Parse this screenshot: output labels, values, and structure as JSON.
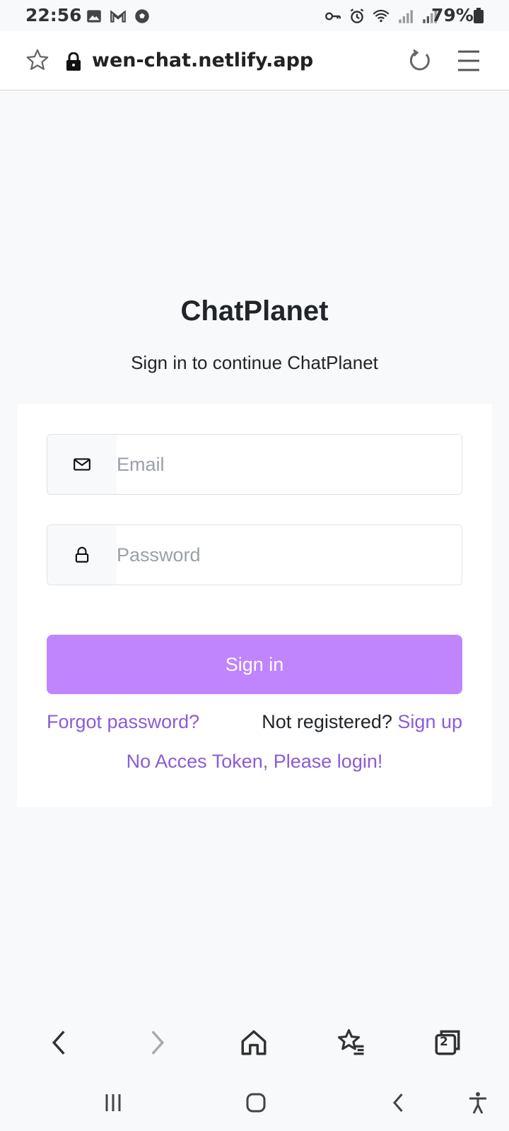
{
  "status_bar": {
    "time": "22:56",
    "battery": "79%",
    "left_icons": [
      "image-icon",
      "gmail-icon",
      "football-icon"
    ],
    "right_icons": [
      "key-icon",
      "alarm-icon",
      "wifi-icon",
      "signal-icon",
      "signal-icon"
    ]
  },
  "address_bar": {
    "url": "wen-chat.netlify.app"
  },
  "page": {
    "title": "ChatPlanet",
    "subtitle": "Sign in to continue ChatPlanet"
  },
  "form": {
    "email_placeholder": "Email",
    "password_placeholder": "Password",
    "email_value": "",
    "password_value": "",
    "submit_label": "Sign in",
    "forgot_label": "Forgot password?",
    "not_registered_label": "Not registered?",
    "signup_label": "Sign up",
    "token_message": "No Acces Token, Please login!"
  },
  "browser_toolbar": {
    "tab_count": "2"
  },
  "colors": {
    "accent": "#c084fc",
    "link": "#8b5cd6",
    "background": "#f8f9fa"
  }
}
